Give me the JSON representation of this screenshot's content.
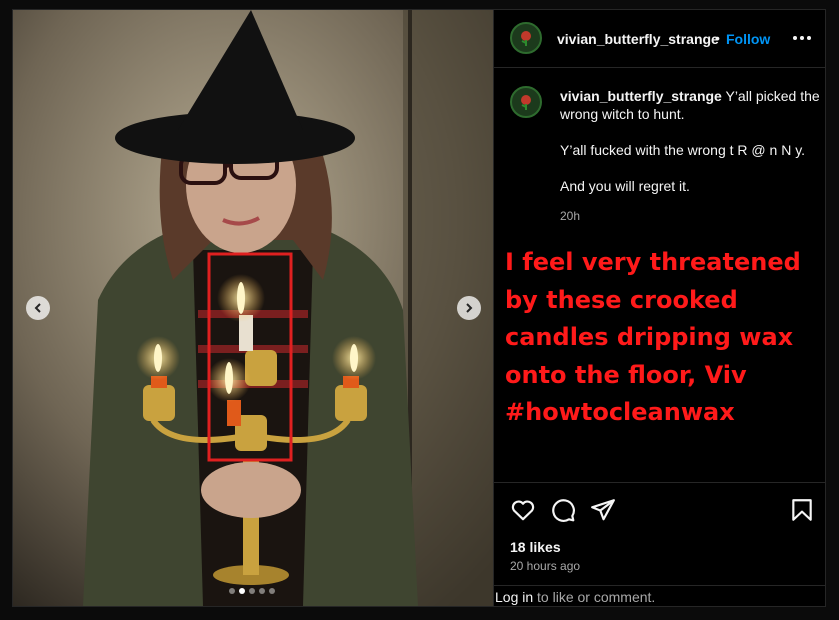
{
  "post": {
    "username": "vivian_butterfly_strange",
    "separator": "•",
    "follow_label": "Follow",
    "caption_lines": [
      "Y’all picked the wrong witch to hunt.",
      "Y’all fucked with the wrong t R @ n N y.",
      "And you will regret it."
    ],
    "caption_time": "20h",
    "likes": "18 likes",
    "posted_ago": "20 hours ago",
    "login_link": "Log in",
    "login_suffix": " to like or comment.",
    "carousel": {
      "total": 5,
      "active": 1
    }
  },
  "overlay_text": [
    "I feel very threatened",
    "by these crooked",
    "candles dripping wax",
    "onto the floor, Viv",
    "#howtocleanwax"
  ],
  "colors": {
    "accent_follow": "#0095f6",
    "overlay_red": "#ff1a1a",
    "annotation_box": "#e02020"
  },
  "icons": [
    "heart-icon",
    "comment-icon",
    "share-icon",
    "bookmark-icon",
    "more-icon",
    "chevron-left-icon",
    "chevron-right-icon"
  ]
}
